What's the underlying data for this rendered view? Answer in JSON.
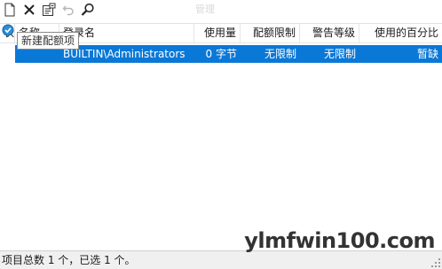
{
  "toolbar": {
    "buttons": [
      {
        "name": "new-quota-entry",
        "icon": "new-document-icon"
      },
      {
        "name": "delete",
        "icon": "delete-x-icon"
      },
      {
        "name": "properties",
        "icon": "properties-icon"
      },
      {
        "name": "undo",
        "icon": "undo-icon"
      },
      {
        "name": "find",
        "icon": "magnifier-icon"
      }
    ],
    "faint_title": "管理"
  },
  "tooltip": {
    "text": "新建配额项"
  },
  "table": {
    "columns": [
      {
        "key": "status",
        "label": "状"
      },
      {
        "key": "name",
        "label": "名称"
      },
      {
        "key": "logon",
        "label": "登录名"
      },
      {
        "key": "used",
        "label": "使用量"
      },
      {
        "key": "limit",
        "label": "配额限制"
      },
      {
        "key": "warning",
        "label": "警告等级"
      },
      {
        "key": "percent",
        "label": "使用的百分比"
      }
    ],
    "rows": [
      {
        "status": "",
        "name": "",
        "logon": "BUILTIN\\Administrators",
        "used": "0 字节",
        "limit": "无限制",
        "warning": "无限制",
        "percent": "暂缺",
        "selected": true
      }
    ]
  },
  "statusbar": {
    "text": "项目总数 1 个，已选 1 个。"
  },
  "watermark": {
    "text": "ylmfwin100.com"
  },
  "colors": {
    "selection": "#0a78d7",
    "status_ok": "#2b8fd8"
  }
}
